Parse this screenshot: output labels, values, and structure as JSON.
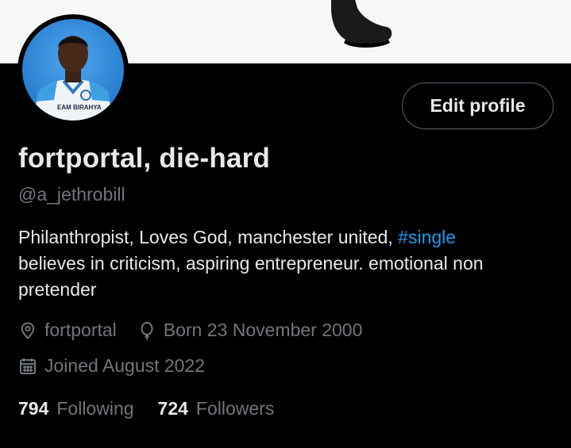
{
  "profile": {
    "display_name": "fortportal, die-hard",
    "handle": "@a_jethrobill",
    "edit_button": "Edit profile",
    "bio_text": "Philanthropist, Loves God, manchester united, ",
    "bio_hashtag": "#single",
    "bio_rest": "believes in criticism, aspiring entrepreneur. emotional  non pretender",
    "location": "fortportal",
    "birthday": "Born 23 November 2000",
    "joined": "Joined August 2022",
    "avatar_shirt_text": "EAM BIRAHYA"
  },
  "stats": {
    "following_count": "794",
    "following_label": "Following",
    "followers_count": "724",
    "followers_label": "Followers"
  },
  "colors": {
    "background": "#000000",
    "primary_text": "#e7e9ea",
    "secondary_text": "#71767b",
    "link": "#1d9bf0",
    "button_border": "#536471"
  },
  "icons": [
    "location-icon",
    "balloon-icon",
    "calendar-icon"
  ]
}
